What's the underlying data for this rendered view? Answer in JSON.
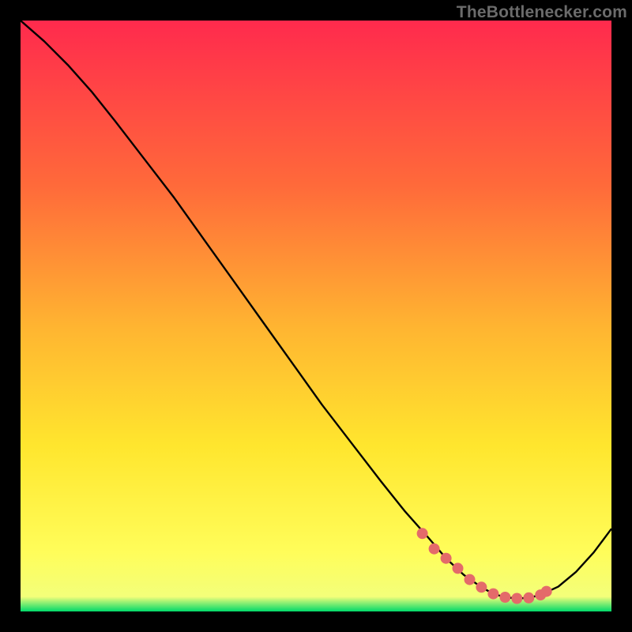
{
  "watermark": "TheBottlenecker.com",
  "colors": {
    "gradient_top": "#ff2a4d",
    "gradient_mid1": "#ff6a3a",
    "gradient_mid2": "#ffb531",
    "gradient_mid3": "#ffe62e",
    "gradient_mid4": "#fffd5a",
    "gradient_low": "#00d96a",
    "curve": "#000000",
    "markers": "#e46a6a"
  },
  "chart_data": {
    "type": "line",
    "title": "",
    "xlabel": "",
    "ylabel": "",
    "xlim": [
      0,
      100
    ],
    "ylim": [
      0,
      100
    ],
    "series": [
      {
        "name": "main-curve",
        "x": [
          0,
          4,
          8,
          12,
          16,
          21,
          26,
          31,
          36,
          41,
          46,
          51,
          56,
          61,
          65,
          69,
          72,
          75,
          78,
          80,
          82,
          84,
          86,
          88,
          91,
          94,
          97,
          100
        ],
        "y": [
          100,
          96.5,
          92.5,
          88,
          83,
          76.5,
          70,
          63,
          56,
          49,
          42,
          35,
          28.5,
          22,
          17,
          12.5,
          9,
          6.2,
          4.1,
          3.0,
          2.4,
          2.2,
          2.3,
          2.8,
          4.2,
          6.7,
          10.0,
          14.0
        ]
      }
    ],
    "markers": {
      "name": "highlight-dots",
      "x": [
        68,
        70,
        72,
        74,
        76,
        78,
        80,
        82,
        84,
        86,
        88,
        89
      ],
      "y": [
        13.2,
        10.6,
        9.0,
        7.3,
        5.4,
        4.1,
        3.0,
        2.4,
        2.2,
        2.3,
        2.8,
        3.4
      ]
    }
  }
}
